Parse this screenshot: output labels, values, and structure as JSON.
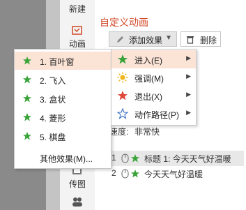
{
  "nav": {
    "new_label": "新建",
    "animation_label": "动画",
    "picture_label": "传图"
  },
  "pane": {
    "title": "自定义动画",
    "add_effect_label": "添加效果",
    "delete_label": "删除",
    "speed_label": "速度:",
    "speed_value": "非常快"
  },
  "animation_list": [
    {
      "number": "1",
      "title": "标题 1: 今天天气好温暖"
    },
    {
      "number": "2",
      "title": "今天天气好温暖"
    }
  ],
  "menu": {
    "items": [
      {
        "label": "进入(E)",
        "icon": "enter-star-green-icon"
      },
      {
        "label": "强调(M)",
        "icon": "emphasis-sun-yellow-icon"
      },
      {
        "label": "退出(X)",
        "icon": "exit-star-red-icon"
      },
      {
        "label": "动作路径(P)",
        "icon": "motion-path-star-outline-icon"
      }
    ]
  },
  "submenu": {
    "items": [
      {
        "label": "1. 百叶窗"
      },
      {
        "label": "2. 飞入"
      },
      {
        "label": "3. 盒状"
      },
      {
        "label": "4. 菱形"
      },
      {
        "label": "5. 棋盘"
      }
    ],
    "more_label": "其他效果(M)..."
  },
  "colors": {
    "accent": "#d24726",
    "highlight": "#fbe3d6",
    "star_green": "#3aa33a"
  }
}
